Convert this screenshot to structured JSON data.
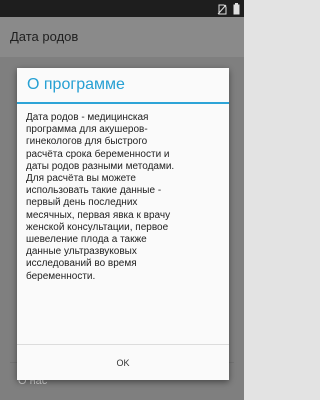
{
  "app_bar": {
    "title": "Дата родов"
  },
  "background_list": {
    "about_item": "О нас"
  },
  "dialog": {
    "title": "О программе",
    "body_lines": [
      "Дата родов - медицинская",
      "программа для акушеров-",
      "гинекологов для быстрого",
      "расчёта срока беременности и",
      "даты родов разными методами.",
      "Для расчёта вы можете",
      "использовать такие данные -",
      "первый день последних",
      "месячных, первая явка к врачу",
      "женской консультации, первое",
      "шевеление плода а также",
      "данные ультразвуковых",
      "исследований во время",
      "беременности."
    ],
    "ok_label": "OK"
  },
  "status_bar": {
    "icons": [
      "no-sim-icon",
      "battery-icon"
    ]
  }
}
